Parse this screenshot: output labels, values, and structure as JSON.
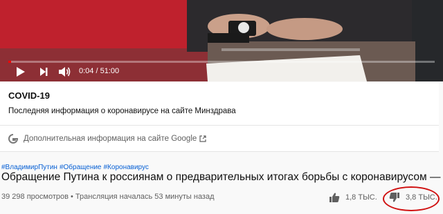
{
  "player": {
    "time_display": "0:04 / 51:00",
    "progress_fraction": 0.0013
  },
  "info_card": {
    "title": "COVID-19",
    "text": "Последняя информация о коронавирусе на сайте Минздрава",
    "google_link": "Дополнительная информация на сайте Google"
  },
  "video": {
    "hashtags": [
      "#ВладимирПутин",
      "#Обращение",
      "#Коронавирус"
    ],
    "title": "Обращение Путина к россиянам о предварительных итогах борьбы с коронавирусом — тр",
    "views": "39 298 просмотров",
    "stream_status": "• Трансляция началась 53 минуты назад",
    "likes": "1,8 ТЫС.",
    "dislikes": "3,8 ТЫС."
  },
  "colors": {
    "accent_link": "#065fd4",
    "highlight_circle": "#d01010",
    "progress": "#ff0000"
  }
}
